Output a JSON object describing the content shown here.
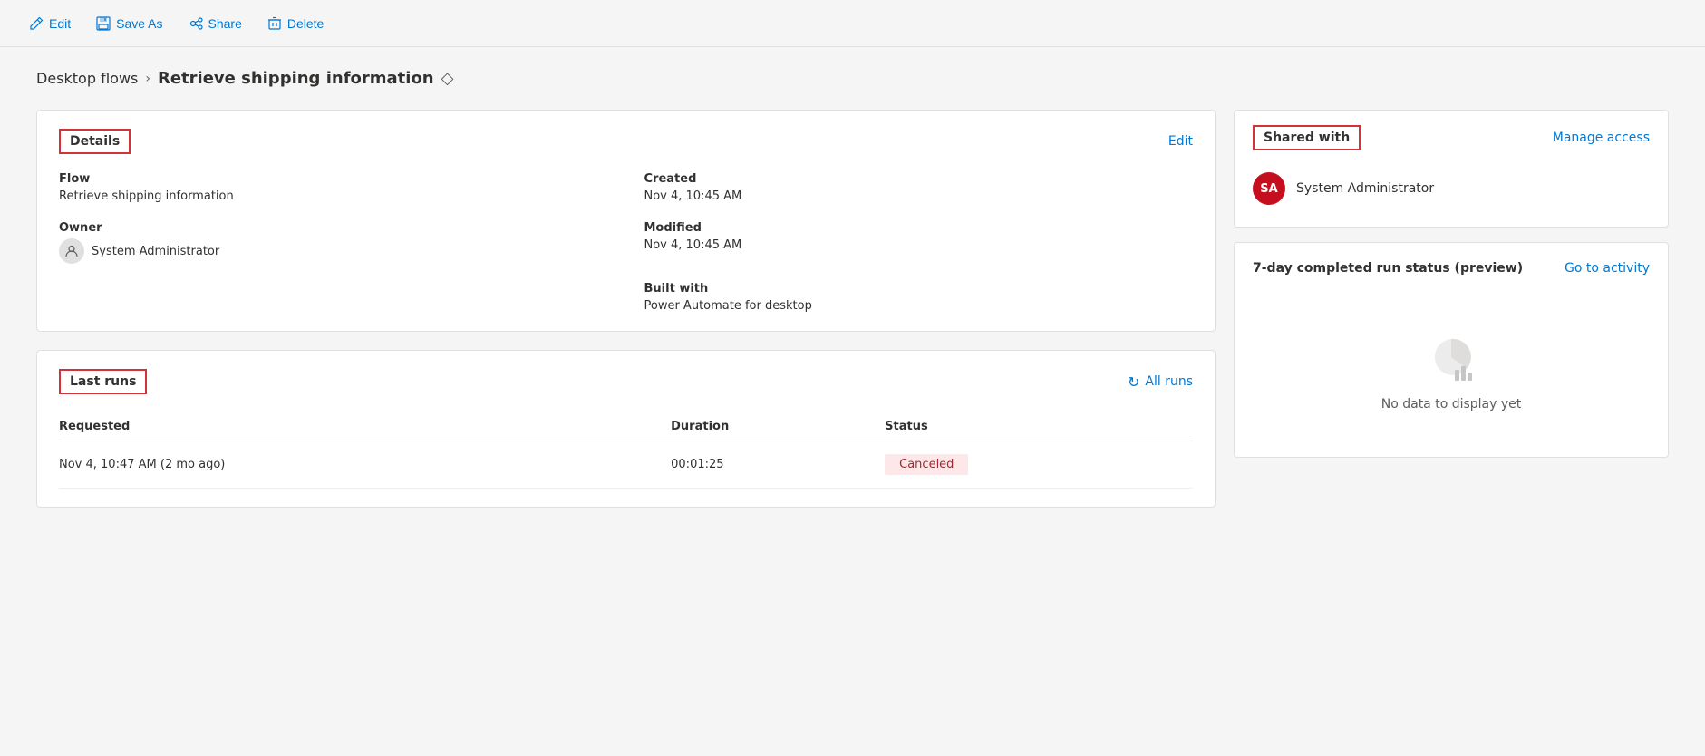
{
  "toolbar": {
    "edit_label": "Edit",
    "save_as_label": "Save As",
    "share_label": "Share",
    "delete_label": "Delete"
  },
  "breadcrumb": {
    "parent": "Desktop flows",
    "current": "Retrieve shipping information"
  },
  "details_card": {
    "title": "Details",
    "edit_link": "Edit",
    "flow_label": "Flow",
    "flow_value": "Retrieve shipping information",
    "owner_label": "Owner",
    "owner_value": "System Administrator",
    "created_label": "Created",
    "created_value": "Nov 4, 10:45 AM",
    "modified_label": "Modified",
    "modified_value": "Nov 4, 10:45 AM",
    "built_with_label": "Built with",
    "built_with_value": "Power Automate for desktop"
  },
  "last_runs_card": {
    "title": "Last runs",
    "all_runs_label": "All runs",
    "columns": {
      "requested": "Requested",
      "duration": "Duration",
      "status": "Status"
    },
    "rows": [
      {
        "requested": "Nov 4, 10:47 AM (2 mo ago)",
        "duration": "00:01:25",
        "status": "Canceled"
      }
    ]
  },
  "shared_with": {
    "title": "Shared with",
    "manage_access_label": "Manage access",
    "users": [
      {
        "initials": "SA",
        "name": "System Administrator"
      }
    ]
  },
  "activity": {
    "title": "7-day completed run status (preview)",
    "go_to_activity_label": "Go to activity",
    "no_data_label": "No data to display yet"
  }
}
